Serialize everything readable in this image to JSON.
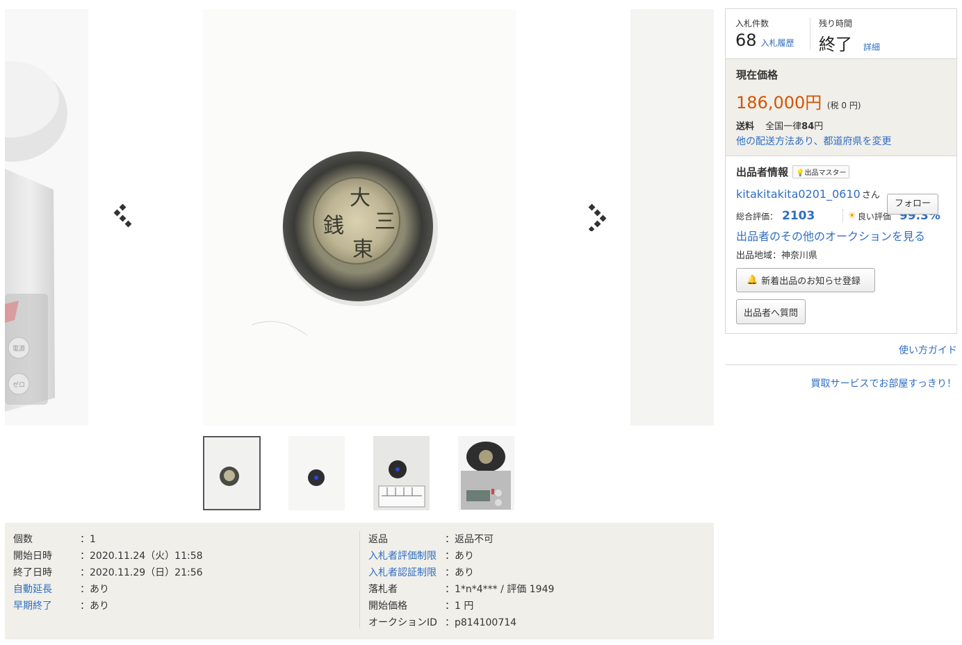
{
  "gallery": {
    "coin_characters": [
      "大",
      "三",
      "東",
      "銭"
    ],
    "scale_buttons": [
      "電源",
      "ゼロ"
    ]
  },
  "thumbnails": [
    {
      "name": "coin-photo-1"
    },
    {
      "name": "coin-photo-2"
    },
    {
      "name": "coin-photo-ruler"
    },
    {
      "name": "coin-photo-scale"
    }
  ],
  "details": {
    "left": [
      {
        "label": "個数",
        "value": "：1",
        "link": false
      },
      {
        "label": "開始日時",
        "value": "：2020.11.24（火）11:58",
        "link": false
      },
      {
        "label": "終了日時",
        "value": "：2020.11.29（日）21:56",
        "link": false
      },
      {
        "label": "自動延長",
        "value": "：あり",
        "link": true
      },
      {
        "label": "早期終了",
        "value": "：あり",
        "link": true
      }
    ],
    "right": [
      {
        "label": "返品",
        "value": "：返品不可",
        "link": false
      },
      {
        "label": "入札者評価制限",
        "value": "：あり",
        "link": true
      },
      {
        "label": "入札者認証制限",
        "value": "：あり",
        "link": true
      },
      {
        "label": "落札者",
        "value": "：1*n*4*** / 評価 1949",
        "link": false
      },
      {
        "label": "開始価格",
        "value": "：1 円",
        "link": false
      },
      {
        "label": "オークションID",
        "value": "：p814100714",
        "link": false
      }
    ]
  },
  "bids": {
    "count_label": "入札件数",
    "count": "68",
    "history_link": "入札履歴",
    "time_label": "残り時間",
    "time_value": "終了",
    "detail_link": "詳細"
  },
  "price": {
    "label": "現在価格",
    "value": "186,000円",
    "tax": "(税 0 円)",
    "shipping_label": "送料",
    "shipping_prefix": "全国一律",
    "shipping_amount": "84",
    "shipping_suffix": "円",
    "shipping_link": "他の配送方法あり、都道府県を変更"
  },
  "seller": {
    "title": "出品者情報",
    "badge": "出品マスター",
    "name": "kitakitakita0201_0610",
    "suffix": "さん",
    "follow": "フォロー",
    "total_rating_label": "総合評価：",
    "total_rating": "2103",
    "good_label": "良い評価",
    "good_percent": "99.3%",
    "other_auctions": "出品者のその他のオークションを見る",
    "region": "出品地域：神奈川県",
    "notify_button": "新着出品のお知らせ登録",
    "ask_button": "出品者へ質問"
  },
  "guide_link": "使い方ガイド",
  "service_link": "買取サービスでお部屋すっきり！",
  "colors": {
    "link": "#2f6ec2",
    "price": "#d35400",
    "panel_bg": "#f0efea"
  }
}
